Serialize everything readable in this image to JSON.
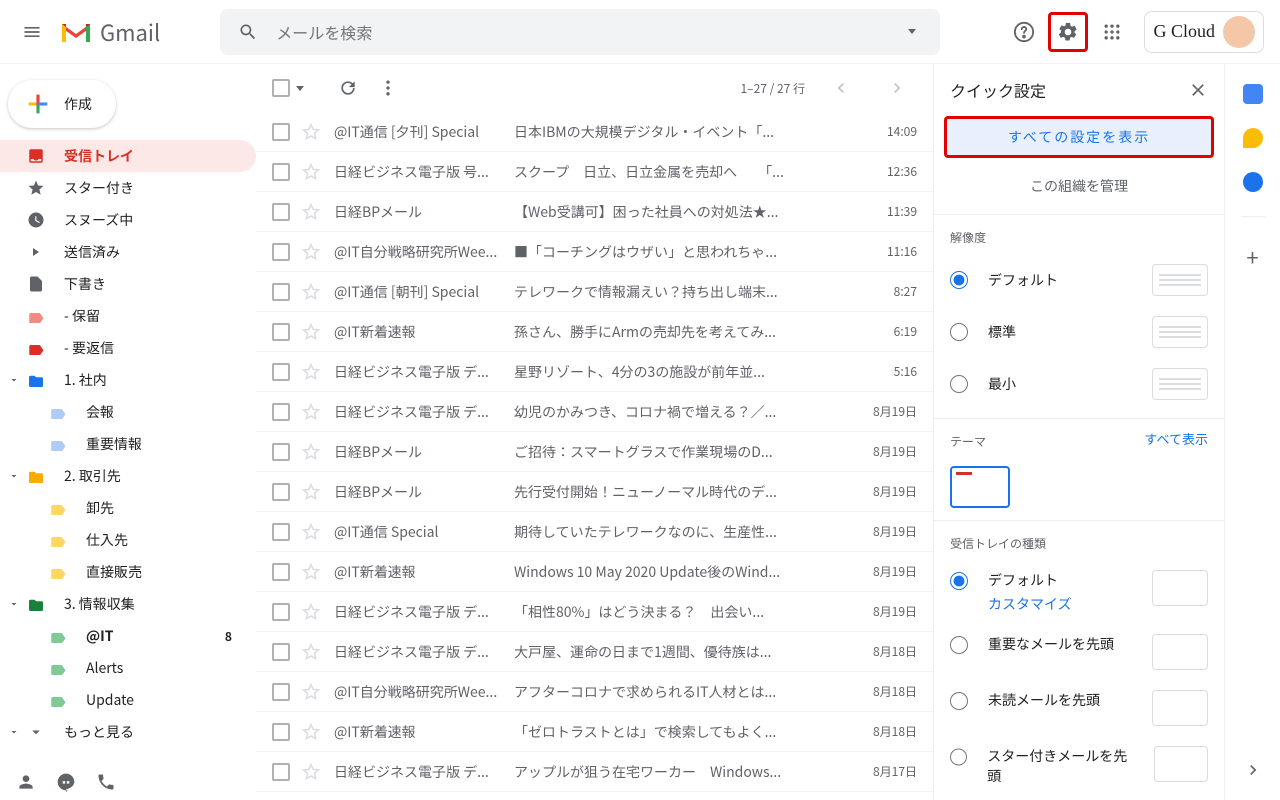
{
  "header": {
    "logo_text": "Gmail",
    "search_placeholder": "メールを検索",
    "account_label": "G Cloud"
  },
  "sidebar": {
    "compose": "作成",
    "items": [
      {
        "label": "受信トレイ"
      },
      {
        "label": "スター付き"
      },
      {
        "label": "スヌーズ中"
      },
      {
        "label": "送信済み"
      },
      {
        "label": "下書き"
      },
      {
        "label": "- 保留"
      },
      {
        "label": "- 要返信"
      },
      {
        "label": "1. 社内"
      },
      {
        "label": "会報"
      },
      {
        "label": "重要情報"
      },
      {
        "label": "2. 取引先"
      },
      {
        "label": "卸先"
      },
      {
        "label": "仕入先"
      },
      {
        "label": "直接販売"
      },
      {
        "label": "3. 情報収集"
      },
      {
        "label": "@IT",
        "count": "8"
      },
      {
        "label": "Alerts"
      },
      {
        "label": "Update"
      },
      {
        "label": "もっと見る"
      }
    ]
  },
  "toolbar": {
    "page_info": "1–27 / 27 行"
  },
  "mails": [
    {
      "sender": "@IT通信 [夕刊] Special",
      "subject": "日本IBMの大規模デジタル・イベント「...",
      "date": "14:09"
    },
    {
      "sender": "日経ビジネス電子版 号...",
      "subject": "スクープ　日立、日立金属を売却へ　　「...",
      "date": "12:36"
    },
    {
      "sender": "日経BPメール",
      "subject": "【Web受講可】困った社員への対処法★...",
      "date": "11:39"
    },
    {
      "sender": "@IT自分戦略研究所Wee...",
      "subject": "■「コーチングはウザい」と思われちゃ...",
      "date": "11:16"
    },
    {
      "sender": "@IT通信 [朝刊] Special",
      "subject": "テレワークで情報漏えい？持ち出し端末...",
      "date": "8:27"
    },
    {
      "sender": "@IT新着速報",
      "subject": "孫さん、勝手にArmの売却先を考えてみ...",
      "date": "6:19"
    },
    {
      "sender": "日経ビジネス電子版 デ...",
      "subject": "星野リゾート、4分の3の施設が前年並...",
      "date": "5:16"
    },
    {
      "sender": "日経ビジネス電子版 デ...",
      "subject": "幼児のかみつき、コロナ禍で増える？／...",
      "date": "8月19日"
    },
    {
      "sender": "日経BPメール",
      "subject": "ご招待：スマートグラスで作業現場のD...",
      "date": "8月19日"
    },
    {
      "sender": "日経BPメール",
      "subject": "先行受付開始！ニューノーマル時代のデ...",
      "date": "8月19日"
    },
    {
      "sender": "@IT通信 Special",
      "subject": "期待していたテレワークなのに、生産性...",
      "date": "8月19日"
    },
    {
      "sender": "@IT新着速報",
      "subject": "Windows 10 May 2020 Update後のWind...",
      "date": "8月19日"
    },
    {
      "sender": "日経ビジネス電子版 デ...",
      "subject": "「相性80%」はどう決まる？　出会い...",
      "date": "8月19日"
    },
    {
      "sender": "日経ビジネス電子版 デ...",
      "subject": "大戸屋、運命の日まで1週間、優待族は...",
      "date": "8月18日"
    },
    {
      "sender": "@IT自分戦略研究所Wee...",
      "subject": "アフターコロナで求められるIT人材とは...",
      "date": "8月18日"
    },
    {
      "sender": "@IT新着速報",
      "subject": "「ゼロトラストとは」で検索してもよく...",
      "date": "8月18日"
    },
    {
      "sender": "日経ビジネス電子版 デ...",
      "subject": "アップルが狙う在宅ワーカー　Windows...",
      "date": "8月17日"
    }
  ],
  "panel": {
    "title": "クイック設定",
    "all_settings": "すべての設定を表示",
    "org_manage": "この組織を管理",
    "density_title": "解像度",
    "density": [
      {
        "label": "デフォルト"
      },
      {
        "label": "標準"
      },
      {
        "label": "最小"
      }
    ],
    "theme_title": "テーマ",
    "theme_all": "すべて表示",
    "inbox_title": "受信トレイの種類",
    "inbox_types": [
      {
        "label": "デフォルト",
        "customize": "カスタマイズ"
      },
      {
        "label": "重要なメールを先頭"
      },
      {
        "label": "未読メールを先頭"
      },
      {
        "label": "スター付きメールを先頭"
      }
    ]
  }
}
